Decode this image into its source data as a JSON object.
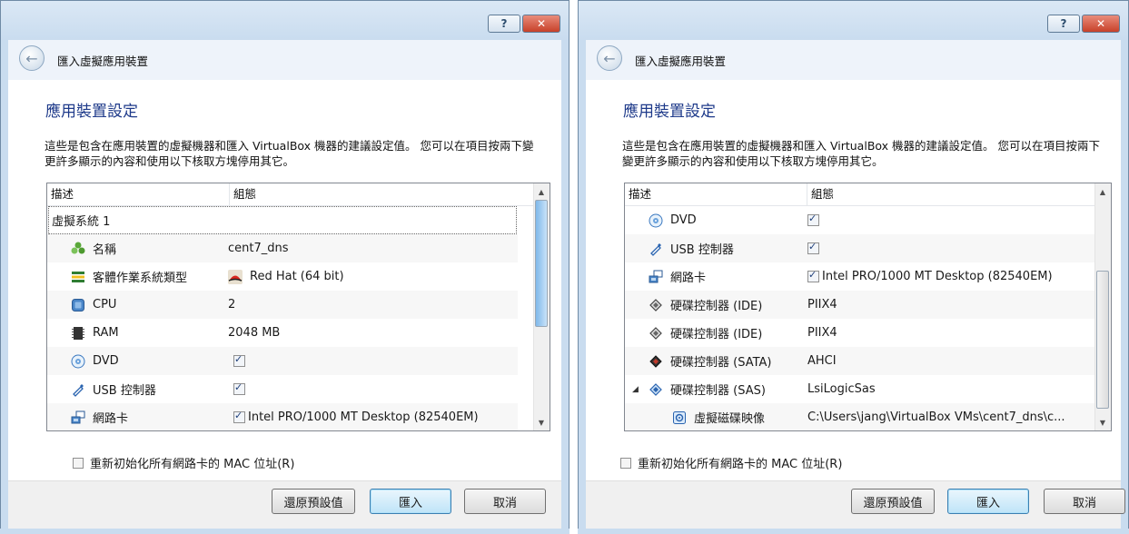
{
  "dialogs": [
    {
      "nav_title": "匯入虛擬應用裝置",
      "heading": "應用裝置設定",
      "description": "這些是包含在應用裝置的虛擬機器和匯入 VirtualBox 機器的建議設定值。 您可以在項目按兩下變更許多顯示的內容和使用以下核取方塊停用其它。",
      "col_desc": "描述",
      "col_config": "組態",
      "group_label": "虛擬系統 1",
      "rows": [
        {
          "label": "名稱",
          "value": "cent7_dns",
          "icon": "name-puzzle-icon"
        },
        {
          "label": "客體作業系統類型",
          "value": "Red Hat (64 bit)",
          "icon": "os-type-icon"
        },
        {
          "label": "CPU",
          "value": "2",
          "icon": "cpu-icon"
        },
        {
          "label": "RAM",
          "value": "2048 MB",
          "icon": "ram-icon"
        },
        {
          "label": "DVD",
          "value": "",
          "icon": "dvd-icon"
        },
        {
          "label": "USB 控制器",
          "value": "",
          "icon": "usb-icon"
        },
        {
          "label": "網路卡",
          "value": "Intel PRO/1000 MT Desktop (82540EM)",
          "icon": "network-card-icon"
        }
      ],
      "mac_label": "重新初始化所有網路卡的 MAC 位址(R)",
      "buttons": {
        "restore": "還原預設值",
        "import": "匯入",
        "cancel": "取消"
      },
      "help_glyph": "?",
      "close_glyph": "✕"
    },
    {
      "nav_title": "匯入虛擬應用裝置",
      "heading": "應用裝置設定",
      "description": "這些是包含在應用裝置的虛擬機器和匯入 VirtualBox 機器的建議設定值。 您可以在項目按兩下變更許多顯示的內容和使用以下核取方塊停用其它。",
      "col_desc": "描述",
      "col_config": "組態",
      "rows": [
        {
          "label": "DVD",
          "value": "",
          "icon": "dvd-icon"
        },
        {
          "label": "USB 控制器",
          "value": "",
          "icon": "usb-icon"
        },
        {
          "label": "網路卡",
          "value": "Intel PRO/1000 MT Desktop (82540EM)",
          "icon": "network-card-icon"
        },
        {
          "label": "硬碟控制器 (IDE)",
          "value": "PIIX4",
          "icon": "ide-controller-icon"
        },
        {
          "label": "硬碟控制器 (IDE)",
          "value": "PIIX4",
          "icon": "ide-controller-icon"
        },
        {
          "label": "硬碟控制器 (SATA)",
          "value": "AHCI",
          "icon": "sata-controller-icon"
        },
        {
          "label": "硬碟控制器 (SAS)",
          "value": "LsiLogicSas",
          "icon": "sas-controller-icon"
        },
        {
          "label": "虛擬磁碟映像",
          "value": "C:\\Users\\jang\\VirtualBox VMs\\cent7_dns\\c...",
          "icon": "disk-image-icon"
        }
      ],
      "mac_label": "重新初始化所有網路卡的 MAC 位址(R)",
      "buttons": {
        "restore": "還原預設值",
        "import": "匯入",
        "cancel": "取消"
      },
      "help_glyph": "?",
      "close_glyph": "✕"
    }
  ]
}
